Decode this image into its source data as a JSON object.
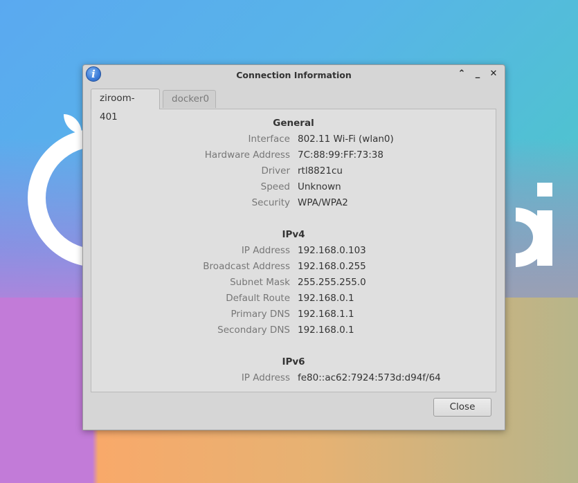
{
  "window": {
    "title": "Connection Information",
    "info_icon_glyph": "i",
    "controls": {
      "maximize": "⌃",
      "minimize": "_",
      "close": "✕"
    }
  },
  "tabs": [
    {
      "label": "ziroom-401",
      "active": true
    },
    {
      "label": "docker0",
      "active": false
    }
  ],
  "general": {
    "title": "General",
    "rows": [
      {
        "label": "Interface",
        "value": "802.11 Wi-Fi (wlan0)"
      },
      {
        "label": "Hardware Address",
        "value": "7C:88:99:FF:73:38"
      },
      {
        "label": "Driver",
        "value": "rtl8821cu"
      },
      {
        "label": "Speed",
        "value": "Unknown"
      },
      {
        "label": "Security",
        "value": "WPA/WPA2"
      }
    ]
  },
  "ipv4": {
    "title": "IPv4",
    "rows": [
      {
        "label": "IP Address",
        "value": "192.168.0.103"
      },
      {
        "label": "Broadcast Address",
        "value": "192.168.0.255"
      },
      {
        "label": "Subnet Mask",
        "value": "255.255.255.0"
      },
      {
        "label": "Default Route",
        "value": "192.168.0.1"
      },
      {
        "label": "Primary DNS",
        "value": "192.168.1.1"
      },
      {
        "label": "Secondary DNS",
        "value": "192.168.0.1"
      }
    ]
  },
  "ipv6": {
    "title": "IPv6",
    "rows": [
      {
        "label": "IP Address",
        "value": "fe80::ac62:7924:573d:d94f/64"
      }
    ]
  },
  "buttons": {
    "close": "Close"
  }
}
